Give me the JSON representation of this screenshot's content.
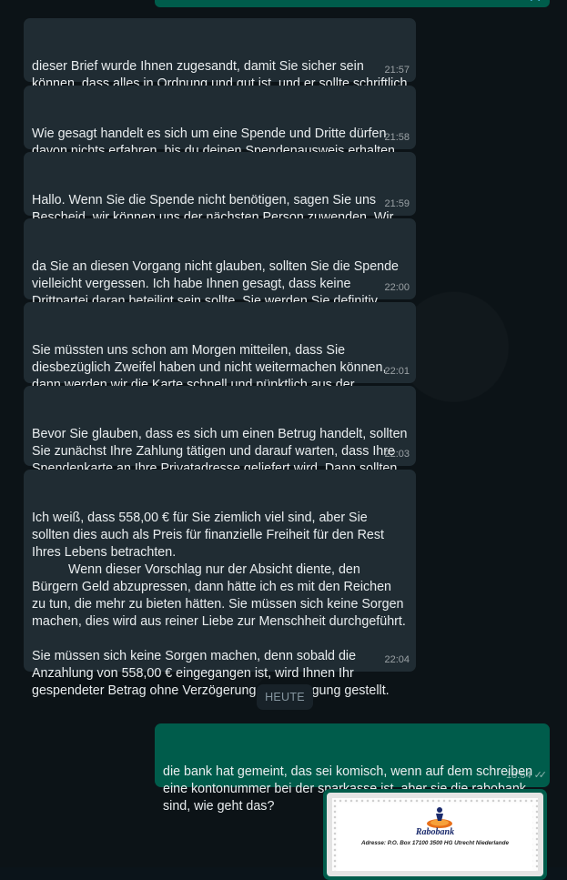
{
  "previous_message": {
    "ticks": "✓✓"
  },
  "messages": [
    {
      "text": "dieser Brief wurde Ihnen zugesandt, damit Sie sicher sein können, dass alles in Ordnung und gut ist, und er sollte schriftlich festgehalten sein.",
      "time": "21:57"
    },
    {
      "text": "Wie gesagt handelt es sich um eine Spende und Dritte dürfen davon nichts erfahren, bis du deinen Spendenausweis erhalten hast. Ich möchte dich nicht entmutigen.",
      "time": "21:58"
    },
    {
      "text": "Hallo. Wenn Sie die Spende nicht benötigen, sagen Sie uns Bescheid, wir können uns der nächsten Person zuwenden. Wir haben nicht zu viel Zeit zu verlieren.",
      "time": "21:59"
    },
    {
      "text": "da Sie an diesen Vorgang nicht glauben, sollten Sie die Spende vielleicht vergessen. Ich habe Ihnen gesagt, dass keine Drittpartei daran beteiligt sein sollte. Sie werden Sie definitiv davon abhalten.",
      "time": "22:00"
    },
    {
      "text": "Sie müssten uns schon am Morgen mitteilen, dass Sie diesbezüglich Zweifel haben und nicht weitermachen können, dann werden wir die Karte schnell und pünktlich aus der Zustellabteilung zurückholen.",
      "time": "22:01"
    },
    {
      "text": "Bevor Sie glauben, dass es sich um einen Betrug handelt, sollten Sie zunächst Ihre Zahlung tätigen und darauf warten, dass Ihre Spendenkarte an Ihre Privatadresse geliefert wird. Dann sollten Sie wissen, dass es sich nicht um einen Betrug handelt.",
      "time": "22:03"
    }
  ],
  "long_message": {
    "part1": "Ich weiß, dass 558,00 € für Sie ziemlich viel sind, aber Sie sollten dies auch als Preis für finanzielle Freiheit für den Rest Ihres Lebens betrachten.",
    "part2": "Wenn dieser Vorschlag nur der Absicht diente, den Bürgern Geld abzupressen, dann hätte ich es mit den Reichen zu tun, die mehr zu bieten hätten. Sie müssen sich keine Sorgen machen, dies wird aus reiner Liebe zur Menschheit durchgeführt.",
    "part3": "Sie müssen sich keine Sorgen machen, denn sobald die Anzahlung von 558,00 € eingegangen ist, wird Ihnen Ihr gespendeter Betrag ohne Verzögerung zur Verfügung gestellt.",
    "time": "22:04"
  },
  "date_divider": "HEUTE",
  "outgoing": {
    "text": "die bank hat gemeint, das sei komisch, wenn auf dem schreiben eine kontonummer bei der sparkasse ist, aber sie die rabobank sind, wie geht das?",
    "time": "18:54",
    "ticks": "✓✓"
  },
  "image_message": {
    "bank_name": "Rabobank",
    "address": "Adresse: P.O. Box 17100 3500 HG Utrecht Niederlande"
  },
  "colors": {
    "incoming_bubble": "#202c33",
    "outgoing_bubble": "#005c4b",
    "background": "#0b141a"
  }
}
